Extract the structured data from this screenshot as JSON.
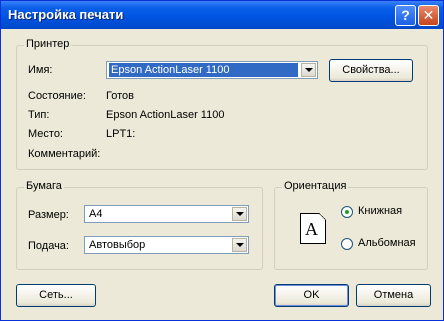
{
  "window": {
    "title": "Настройка печати",
    "help_glyph": "?",
    "close_glyph": "✕"
  },
  "printer": {
    "group_label": "Принтер",
    "name_label": "Имя:",
    "name_value": "Epson ActionLaser 1100",
    "properties_button": "Свойства...",
    "status_label": "Состояние:",
    "status_value": "Готов",
    "type_label": "Тип:",
    "type_value": "Epson ActionLaser 1100",
    "where_label": "Место:",
    "where_value": "LPT1:",
    "comment_label": "Комментарий:",
    "comment_value": ""
  },
  "paper": {
    "group_label": "Бумага",
    "size_label": "Размер:",
    "size_value": "A4",
    "source_label": "Подача:",
    "source_value": "Автовыбор"
  },
  "orientation": {
    "group_label": "Ориентация",
    "page_letter": "A",
    "options": [
      {
        "label": "Книжная",
        "checked": true
      },
      {
        "label": "Альбомная",
        "checked": false
      }
    ]
  },
  "buttons": {
    "network": "Сеть...",
    "ok": "OK",
    "cancel": "Отмена"
  },
  "icons": {
    "dropdown": "chevron-down-icon",
    "help": "help-icon",
    "close": "close-icon",
    "page": "portrait-page-icon"
  },
  "colors": {
    "titlebar": "#0054e3",
    "selection": "#316ac5",
    "dialog_bg": "#ece9d8"
  }
}
